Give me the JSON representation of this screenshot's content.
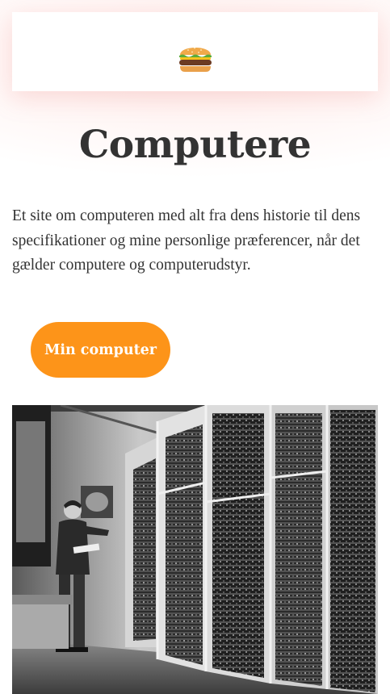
{
  "header": {
    "menu_icon": "hamburger-emoji-icon"
  },
  "main": {
    "title": "Computere",
    "intro": "Et site om computeren med alt fra dens historie til dens specifikationer og mine personlige præferencer, når det gælder computere og computerudstyr.",
    "cta_label": "Min computer"
  },
  "hero_image": {
    "subject": "man-with-mainframe-computer-photo"
  },
  "colors": {
    "accent": "#fd9419",
    "text": "#333333",
    "background": "#ffffff"
  }
}
